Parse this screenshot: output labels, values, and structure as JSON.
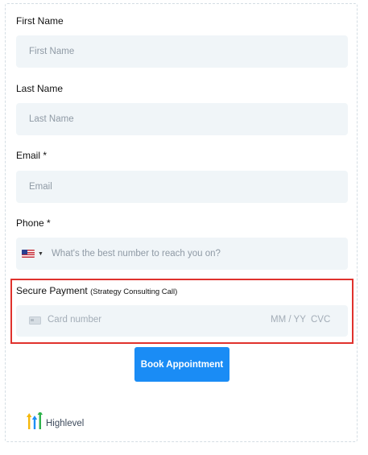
{
  "form": {
    "first_name": {
      "label": "First Name",
      "placeholder": "First Name",
      "value": ""
    },
    "last_name": {
      "label": "Last Name",
      "placeholder": "Last Name",
      "value": ""
    },
    "email": {
      "label": "Email *",
      "placeholder": "Email",
      "value": ""
    },
    "phone": {
      "label": "Phone *",
      "placeholder": "What's the best number to reach you on?",
      "value": "",
      "country_flag": "us-flag-icon"
    },
    "payment": {
      "label": "Secure Payment",
      "sublabel": "(Strategy Consulting Call)",
      "card_placeholder": "Card number",
      "expiry_placeholder": "MM / YY",
      "cvc_placeholder": "CVC"
    },
    "submit_label": "Book Appointment"
  },
  "footer": {
    "brand": "Highlevel"
  },
  "colors": {
    "accent": "#1a8cf5",
    "field_bg": "#f0f5f8",
    "highlight_border": "#e0322d",
    "logo_yellow": "#f5b80c",
    "logo_blue": "#1c8ef5",
    "logo_green": "#2fb24c"
  }
}
